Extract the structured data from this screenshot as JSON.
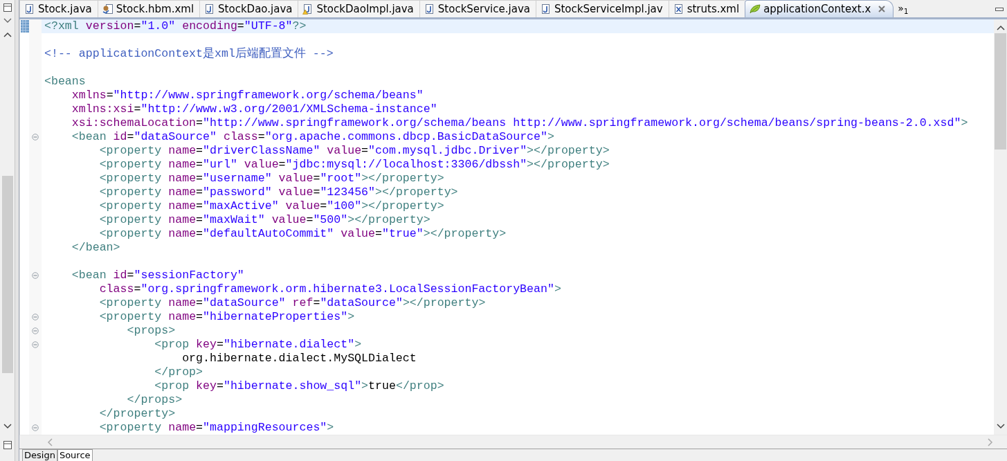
{
  "editor_tabs": [
    {
      "label": "Stock.java",
      "kind": "java",
      "selected": false
    },
    {
      "label": "Stock.hbm.xml",
      "kind": "hibernate",
      "selected": false
    },
    {
      "label": "StockDao.java",
      "kind": "java",
      "selected": false
    },
    {
      "label": "StockDaoImpl.java",
      "kind": "java-warning",
      "selected": false
    },
    {
      "label": "StockService.java",
      "kind": "java",
      "selected": false
    },
    {
      "label": "StockServiceImpl.jav",
      "kind": "java",
      "selected": false
    },
    {
      "label": "struts.xml",
      "kind": "xml",
      "selected": false
    },
    {
      "label": "applicationContext.x",
      "kind": "spring",
      "selected": true
    }
  ],
  "overflow": {
    "symbol": "»",
    "count": "1"
  },
  "code_lines": [
    {
      "current": true,
      "tokens": [
        {
          "kind": "tag",
          "text": "<?xml"
        },
        {
          "kind": "attr",
          "text": " version"
        },
        {
          "kind": "text",
          "text": "="
        },
        {
          "kind": "value",
          "text": "\"1.0\""
        },
        {
          "kind": "attr",
          "text": " encoding"
        },
        {
          "kind": "text",
          "text": "="
        },
        {
          "kind": "value",
          "text": "\"UTF-8\""
        },
        {
          "kind": "tag",
          "text": "?>"
        }
      ]
    },
    {
      "gap_before": true,
      "tokens": [
        {
          "kind": "comment",
          "text": "<!-- applicationContext是xml后端配置文件 -->"
        }
      ]
    },
    {
      "gap_before": true,
      "tokens": [
        {
          "kind": "tag",
          "text": "<beans"
        }
      ]
    },
    {
      "tokens": [
        {
          "kind": "attr",
          "text": "    xmlns"
        },
        {
          "kind": "text",
          "text": "="
        },
        {
          "kind": "value",
          "text": "\"http://www.springframework.org/schema/beans\""
        }
      ]
    },
    {
      "tokens": [
        {
          "kind": "attr",
          "text": "    xmlns:xsi"
        },
        {
          "kind": "text",
          "text": "="
        },
        {
          "kind": "value",
          "text": "\"http://www.w3.org/2001/XMLSchema-instance\""
        }
      ]
    },
    {
      "tokens": [
        {
          "kind": "attr",
          "text": "    xsi:schemaLocation"
        },
        {
          "kind": "text",
          "text": "="
        },
        {
          "kind": "value",
          "text": "\"http://www.springframework.org/schema/beans http://www.springframework.org/schema/beans/spring-beans-2.0.xsd\""
        },
        {
          "kind": "tag",
          "text": ">"
        }
      ]
    },
    {
      "fold": true,
      "tokens": [
        {
          "kind": "tag",
          "text": "    <bean"
        },
        {
          "kind": "attr",
          "text": " id"
        },
        {
          "kind": "text",
          "text": "="
        },
        {
          "kind": "value",
          "text": "\"dataSource\""
        },
        {
          "kind": "attr",
          "text": " class"
        },
        {
          "kind": "text",
          "text": "="
        },
        {
          "kind": "value",
          "text": "\"org.apache.commons.dbcp.BasicDataSource\""
        },
        {
          "kind": "tag",
          "text": ">"
        }
      ]
    },
    {
      "tokens": [
        {
          "kind": "tag",
          "text": "        <property"
        },
        {
          "kind": "attr",
          "text": " name"
        },
        {
          "kind": "text",
          "text": "="
        },
        {
          "kind": "value",
          "text": "\"driverClassName\""
        },
        {
          "kind": "attr",
          "text": " value"
        },
        {
          "kind": "text",
          "text": "="
        },
        {
          "kind": "value",
          "text": "\"com.mysql.jdbc.Driver\""
        },
        {
          "kind": "tag",
          "text": "></property>"
        }
      ]
    },
    {
      "tokens": [
        {
          "kind": "tag",
          "text": "        <property"
        },
        {
          "kind": "attr",
          "text": " name"
        },
        {
          "kind": "text",
          "text": "="
        },
        {
          "kind": "value",
          "text": "\"url\""
        },
        {
          "kind": "attr",
          "text": " value"
        },
        {
          "kind": "text",
          "text": "="
        },
        {
          "kind": "value",
          "text": "\"jdbc:mysql://localhost:3306/dbssh\""
        },
        {
          "kind": "tag",
          "text": "></property>"
        }
      ]
    },
    {
      "tokens": [
        {
          "kind": "tag",
          "text": "        <property"
        },
        {
          "kind": "attr",
          "text": " name"
        },
        {
          "kind": "text",
          "text": "="
        },
        {
          "kind": "value",
          "text": "\"username\""
        },
        {
          "kind": "attr",
          "text": " value"
        },
        {
          "kind": "text",
          "text": "="
        },
        {
          "kind": "value",
          "text": "\"root\""
        },
        {
          "kind": "tag",
          "text": "></property>"
        }
      ]
    },
    {
      "tokens": [
        {
          "kind": "tag",
          "text": "        <property"
        },
        {
          "kind": "attr",
          "text": " name"
        },
        {
          "kind": "text",
          "text": "="
        },
        {
          "kind": "value",
          "text": "\"password\""
        },
        {
          "kind": "attr",
          "text": " value"
        },
        {
          "kind": "text",
          "text": "="
        },
        {
          "kind": "value",
          "text": "\"123456\""
        },
        {
          "kind": "tag",
          "text": "></property>"
        }
      ]
    },
    {
      "tokens": [
        {
          "kind": "tag",
          "text": "        <property"
        },
        {
          "kind": "attr",
          "text": " name"
        },
        {
          "kind": "text",
          "text": "="
        },
        {
          "kind": "value",
          "text": "\"maxActive\""
        },
        {
          "kind": "attr",
          "text": " value"
        },
        {
          "kind": "text",
          "text": "="
        },
        {
          "kind": "value",
          "text": "\"100\""
        },
        {
          "kind": "tag",
          "text": "></property>"
        }
      ]
    },
    {
      "tokens": [
        {
          "kind": "tag",
          "text": "        <property"
        },
        {
          "kind": "attr",
          "text": " name"
        },
        {
          "kind": "text",
          "text": "="
        },
        {
          "kind": "value",
          "text": "\"maxWait\""
        },
        {
          "kind": "attr",
          "text": " value"
        },
        {
          "kind": "text",
          "text": "="
        },
        {
          "kind": "value",
          "text": "\"500\""
        },
        {
          "kind": "tag",
          "text": "></property>"
        }
      ]
    },
    {
      "tokens": [
        {
          "kind": "tag",
          "text": "        <property"
        },
        {
          "kind": "attr",
          "text": " name"
        },
        {
          "kind": "text",
          "text": "="
        },
        {
          "kind": "value",
          "text": "\"defaultAutoCommit\""
        },
        {
          "kind": "attr",
          "text": " value"
        },
        {
          "kind": "text",
          "text": "="
        },
        {
          "kind": "value",
          "text": "\"true\""
        },
        {
          "kind": "tag",
          "text": "></property>"
        }
      ]
    },
    {
      "tokens": [
        {
          "kind": "tag",
          "text": "    </bean>"
        }
      ]
    },
    {
      "gap_before": true,
      "fold": true,
      "tokens": [
        {
          "kind": "tag",
          "text": "    <bean"
        },
        {
          "kind": "attr",
          "text": " id"
        },
        {
          "kind": "text",
          "text": "="
        },
        {
          "kind": "value",
          "text": "\"sessionFactory\""
        }
      ]
    },
    {
      "tokens": [
        {
          "kind": "attr",
          "text": "        class"
        },
        {
          "kind": "text",
          "text": "="
        },
        {
          "kind": "value",
          "text": "\"org.springframework.orm.hibernate3.LocalSessionFactoryBean\""
        },
        {
          "kind": "tag",
          "text": ">"
        }
      ]
    },
    {
      "tokens": [
        {
          "kind": "tag",
          "text": "        <property"
        },
        {
          "kind": "attr",
          "text": " name"
        },
        {
          "kind": "text",
          "text": "="
        },
        {
          "kind": "value",
          "text": "\"dataSource\""
        },
        {
          "kind": "attr",
          "text": " ref"
        },
        {
          "kind": "text",
          "text": "="
        },
        {
          "kind": "value",
          "text": "\"dataSource\""
        },
        {
          "kind": "tag",
          "text": "></property>"
        }
      ]
    },
    {
      "fold": true,
      "tokens": [
        {
          "kind": "tag",
          "text": "        <property"
        },
        {
          "kind": "attr",
          "text": " name"
        },
        {
          "kind": "text",
          "text": "="
        },
        {
          "kind": "value",
          "text": "\"hibernateProperties\""
        },
        {
          "kind": "tag",
          "text": ">"
        }
      ]
    },
    {
      "fold": true,
      "tokens": [
        {
          "kind": "tag",
          "text": "            <props>"
        }
      ]
    },
    {
      "fold": true,
      "tokens": [
        {
          "kind": "tag",
          "text": "                <prop"
        },
        {
          "kind": "attr",
          "text": " key"
        },
        {
          "kind": "text",
          "text": "="
        },
        {
          "kind": "value",
          "text": "\"hibernate.dialect\""
        },
        {
          "kind": "tag",
          "text": ">"
        }
      ]
    },
    {
      "tokens": [
        {
          "kind": "text",
          "text": "                    org.hibernate.dialect.MySQLDialect"
        }
      ]
    },
    {
      "tokens": [
        {
          "kind": "tag",
          "text": "                </prop>"
        }
      ]
    },
    {
      "tokens": [
        {
          "kind": "tag",
          "text": "                <prop"
        },
        {
          "kind": "attr",
          "text": " key"
        },
        {
          "kind": "text",
          "text": "="
        },
        {
          "kind": "value",
          "text": "\"hibernate.show_sql\""
        },
        {
          "kind": "tag",
          "text": ">"
        },
        {
          "kind": "text",
          "text": "true"
        },
        {
          "kind": "tag",
          "text": "</prop>"
        }
      ]
    },
    {
      "tokens": [
        {
          "kind": "tag",
          "text": "            </props>"
        }
      ]
    },
    {
      "tokens": [
        {
          "kind": "tag",
          "text": "        </property>"
        }
      ]
    },
    {
      "fold": true,
      "tokens": [
        {
          "kind": "tag",
          "text": "        <property"
        },
        {
          "kind": "attr",
          "text": " name"
        },
        {
          "kind": "text",
          "text": "="
        },
        {
          "kind": "value",
          "text": "\"mappingResources\""
        },
        {
          "kind": "tag",
          "text": ">"
        }
      ]
    }
  ],
  "page_tabs": [
    {
      "label": "Design",
      "selected": false
    },
    {
      "label": "Source",
      "selected": true
    }
  ]
}
